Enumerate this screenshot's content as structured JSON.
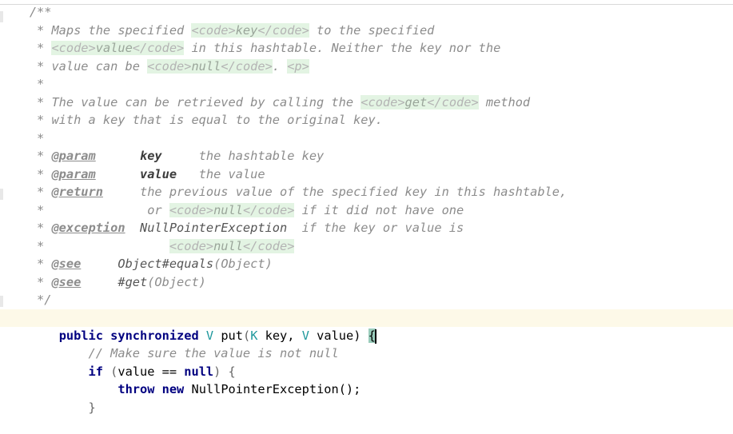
{
  "editor": {
    "lines": [
      {
        "t": "    /**"
      },
      {
        "t": "     * Maps the specified ",
        "tag1": "<code>",
        "v1": "key",
        "tag2": "</code>",
        "rest": " to the specified"
      },
      {
        "t": "     * ",
        "tag1": "<code>",
        "v1": "value",
        "tag2": "</code>",
        "rest": " in this hashtable. Neither the key nor the"
      },
      {
        "t": "     * value can be ",
        "tag1": "<code>",
        "v1": "null",
        "tag2": "</code>",
        "rest": ". ",
        "tag3": "<p>"
      },
      {
        "t": "     *"
      },
      {
        "t": "     * The value can be retrieved by calling the ",
        "tag1": "<code>",
        "v1": "get",
        "tag2": "</code>",
        "rest": " method"
      },
      {
        "t": "     * with a key that is equal to the original key."
      },
      {
        "t": "     *"
      },
      {
        "t": "     * ",
        "doctag": "@param",
        "pad": "      ",
        "name": "key",
        "gap": "     ",
        "desc": "the hashtable key"
      },
      {
        "t": "     * ",
        "doctag": "@param",
        "pad": "      ",
        "name": "value",
        "gap": "   ",
        "desc": "the value"
      },
      {
        "t": "     * ",
        "doctag": "@return",
        "pad": "     ",
        "desc2": "the previous value of the specified key in this hashtable,"
      },
      {
        "t": "     *              or ",
        "tag1": "<code>",
        "v1": "null",
        "tag2": "</code>",
        "rest": " if it did not have one"
      },
      {
        "t": "     * ",
        "doctag": "@exception",
        "pad": "  ",
        "ref": "NullPointerException",
        "rest2": "  if the key or value is"
      },
      {
        "t": "     *                 ",
        "tag1": "<code>",
        "v1": "null",
        "tag2": "</code>"
      },
      {
        "t": "     * ",
        "doctag": "@see",
        "pad": "     ",
        "ref": "Object#equals",
        "sig": "(Object)"
      },
      {
        "t": "     * ",
        "doctag": "@see",
        "pad": "     ",
        "ref": "#get",
        "sig": "(Object)"
      },
      {
        "t": "     */"
      }
    ],
    "signature": {
      "kw_public": "public",
      "kw_sync": "synchronized",
      "type_v": "V",
      "method": "put",
      "open": "(",
      "type_k": "K",
      "arg1": "key",
      "comma": ",",
      "type_v2": "V",
      "arg2": "value",
      "close": ")",
      "brace": "{"
    },
    "comment_line": "// Make sure the value is not null",
    "if_line": {
      "kw": "if",
      "open": " (",
      "var": "value",
      "op": " == ",
      "lit": "null",
      "close": ") {"
    },
    "throw_line": {
      "kw1": "throw",
      "kw2": "new",
      "cls": "NullPointerException",
      "call": "();"
    },
    "close_brace": "}"
  }
}
